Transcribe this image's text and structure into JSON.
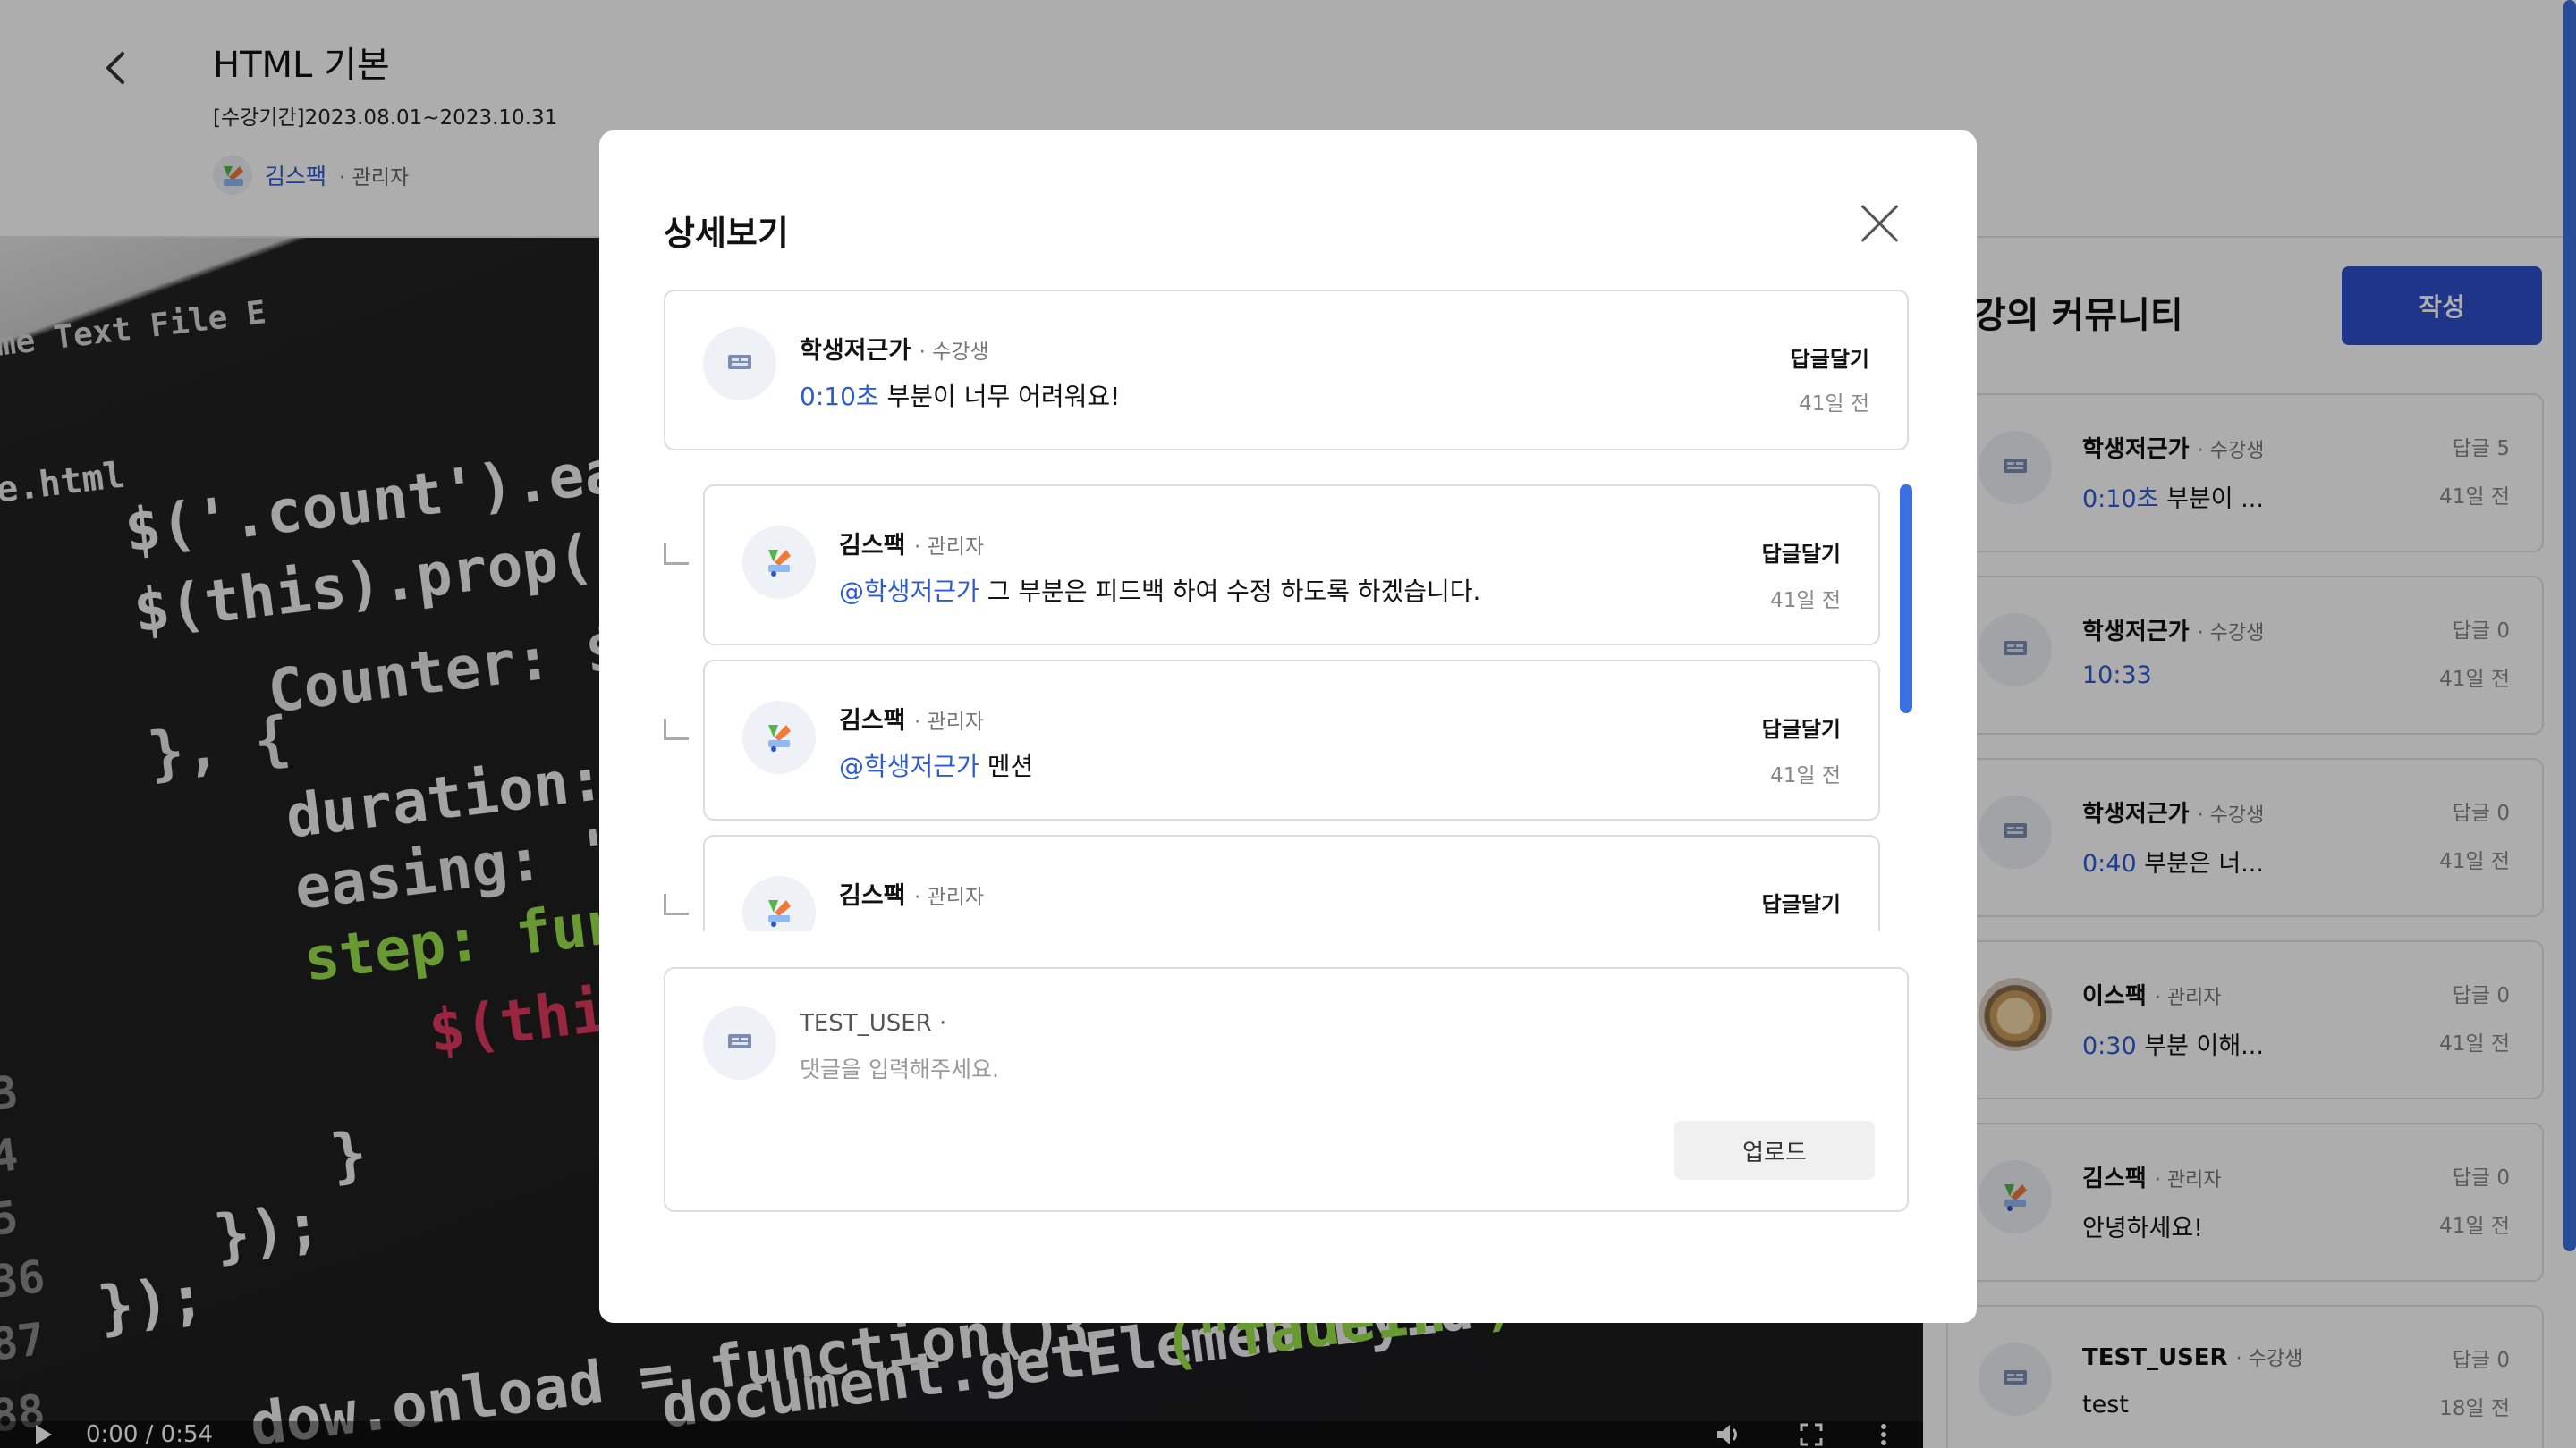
{
  "header": {
    "title": "HTML 기본",
    "period": "[수강기간]2023.08.01~2023.10.31",
    "instructor_name": "김스팩",
    "instructor_role": "· 관리자"
  },
  "video": {
    "time": "0:00 / 0:54",
    "code_lines": [
      {
        "text": "me Text   File   E",
        "color": "#d6d6d6"
      },
      {
        "text": "e.html",
        "color": "#e8e8e8"
      },
      {
        "text": "$('.count').each",
        "color": "#f2f2f2"
      },
      {
        "text": "$(this).prop('C",
        "color": "#f2f2f2"
      },
      {
        "text": "Counter: $(",
        "color": "#e8e8e8"
      },
      {
        "text": "}, {",
        "color": "#e8e8e8"
      },
      {
        "text": "duration:",
        "color": "#f2f2f2"
      },
      {
        "text": "easing: 's",
        "color": "#e8e8e8"
      },
      {
        "text": "step: func",
        "color": "#9be24a"
      },
      {
        "text": "$(this",
        "color": "#e0385e"
      },
      {
        "text": "}",
        "color": "#f2f2f2"
      },
      {
        "text": "});",
        "color": "#f2f2f2"
      },
      {
        "text": "});",
        "color": "#f2f2f2"
      },
      {
        "text": "dow.onload = function(){",
        "color": "#f2f2f2"
      },
      {
        "text": "document.getElementById",
        "color": "#f2f2f2"
      },
      {
        "text": "(\"fadeIn\").onclick =",
        "color": "#9be24a"
      },
      {
        "text": "3",
        "color": "#8a8a8a"
      },
      {
        "text": "4",
        "color": "#8a8a8a"
      },
      {
        "text": "5",
        "color": "#8a8a8a"
      },
      {
        "text": "36",
        "color": "#8a8a8a"
      },
      {
        "text": "87",
        "color": "#8a8a8a"
      },
      {
        "text": "88",
        "color": "#8a8a8a"
      }
    ]
  },
  "community": {
    "title": "강의 커뮤니티",
    "write_label": "작성",
    "items": [
      {
        "author": "학생저근가",
        "role": "· 수강생",
        "time": "0:10초",
        "text": " 부분이 ...",
        "replies": "답글 5",
        "date": "41일 전",
        "avatar": "logo"
      },
      {
        "author": "학생저근가",
        "role": "· 수강생",
        "time": "10:33",
        "text": "",
        "replies": "답글 0",
        "date": "41일 전",
        "avatar": "logo"
      },
      {
        "author": "학생저근가",
        "role": "· 수강생",
        "time": "0:40",
        "text": " 부분은 너...",
        "replies": "답글 0",
        "date": "41일 전",
        "avatar": "logo"
      },
      {
        "author": "이스팩",
        "role": "· 관리자",
        "time": "0:30",
        "text": " 부분 이해...",
        "replies": "답글 0",
        "date": "41일 전",
        "avatar": "photo"
      },
      {
        "author": "김스팩",
        "role": "· 관리자",
        "time": "",
        "text": "안녕하세요!",
        "replies": "답글 0",
        "date": "41일 전",
        "avatar": "brand"
      },
      {
        "author": "TEST_USER",
        "role": "· 수강생",
        "time": "",
        "text": "test",
        "replies": "답글 0",
        "date": "18일 전",
        "avatar": "logo"
      }
    ]
  },
  "modal": {
    "title": "상세보기",
    "main_comment": {
      "author": "학생저근가",
      "role": "· 수강생",
      "time": "0:10초",
      "text": " 부분이 너무 어려워요!",
      "reply_label": "답글달기",
      "date": "41일 전"
    },
    "replies": [
      {
        "author": "김스팩",
        "role": "· 관리자",
        "mention": "@학생저근가",
        "text": " 그 부분은 피드백 하여 수정 하도록 하겠습니다.",
        "reply_label": "답글달기",
        "date": "41일 전"
      },
      {
        "author": "김스팩",
        "role": "· 관리자",
        "mention": "@학생저근가",
        "text": " 멘션",
        "reply_label": "답글달기",
        "date": "41일 전"
      },
      {
        "author": "김스팩",
        "role": "· 관리자",
        "mention": "",
        "text": "",
        "reply_label": "답글달기",
        "date": ""
      }
    ],
    "composer": {
      "user": "TEST_USER ·",
      "placeholder": "댓글을 입력해주세요.",
      "upload_label": "업로드"
    }
  },
  "colors": {
    "accent": "#2d5bd1",
    "button_primary": "#2d4fcb",
    "scrollbar": "#3c6fe4"
  }
}
